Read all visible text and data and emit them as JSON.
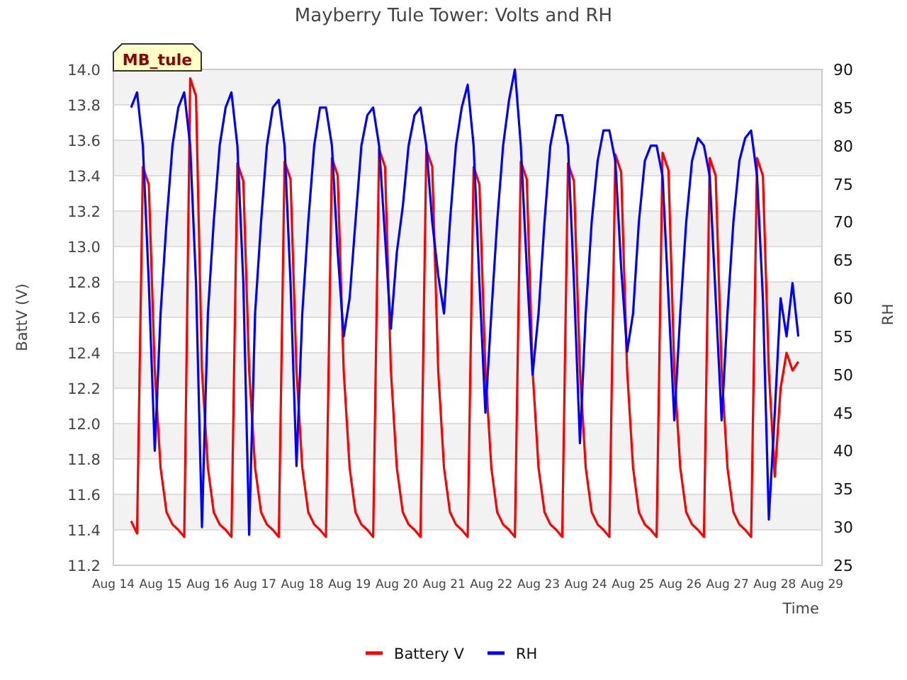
{
  "tag": {
    "label": "MB_tule"
  },
  "chart_data": {
    "type": "line",
    "title": "Mayberry Tule Tower: Volts and RH",
    "xlabel": "Time",
    "ylabel": "BattV (V)",
    "categories": [
      "Aug 14",
      null,
      null,
      null,
      null,
      null,
      null,
      null,
      "Aug 15",
      null,
      null,
      null,
      null,
      null,
      null,
      null,
      "Aug 16",
      null,
      null,
      null,
      null,
      null,
      null,
      null,
      "Aug 17",
      null,
      null,
      null,
      null,
      null,
      null,
      null,
      "Aug 18",
      null,
      null,
      null,
      null,
      null,
      null,
      null,
      "Aug 19",
      null,
      null,
      null,
      null,
      null,
      null,
      null,
      "Aug 20",
      null,
      null,
      null,
      null,
      null,
      null,
      null,
      "Aug 21",
      null,
      null,
      null,
      null,
      null,
      null,
      null,
      "Aug 22",
      null,
      null,
      null,
      null,
      null,
      null,
      null,
      "Aug 23",
      null,
      null,
      null,
      null,
      null,
      null,
      null,
      "Aug 24",
      null,
      null,
      null,
      null,
      null,
      null,
      null,
      "Aug 25",
      null,
      null,
      null,
      null,
      null,
      null,
      null,
      "Aug 26",
      null,
      null,
      null,
      null,
      null,
      null,
      null,
      "Aug 27",
      null,
      null,
      null,
      null,
      null,
      null,
      null,
      "Aug 28",
      null,
      null,
      null,
      null,
      null,
      null,
      null,
      "Aug 29"
    ],
    "series": [
      {
        "name": "Battery V",
        "color": "#ff0000",
        "values": [
          null,
          null,
          null,
          11.45,
          11.38,
          13.45,
          13.35,
          12.3,
          11.75,
          11.5,
          11.43,
          11.4,
          11.36,
          13.95,
          13.85,
          12.3,
          11.75,
          11.5,
          11.43,
          11.4,
          11.36,
          13.47,
          13.37,
          12.3,
          11.75,
          11.5,
          11.43,
          11.4,
          11.36,
          13.48,
          13.38,
          12.3,
          11.75,
          11.5,
          11.43,
          11.4,
          11.36,
          13.5,
          13.4,
          12.3,
          11.75,
          11.5,
          11.43,
          11.4,
          11.36,
          13.55,
          13.45,
          12.3,
          11.75,
          11.5,
          11.43,
          11.4,
          11.36,
          13.55,
          13.45,
          12.3,
          11.75,
          11.5,
          11.43,
          11.4,
          11.36,
          13.45,
          13.35,
          12.3,
          11.75,
          11.5,
          11.43,
          11.4,
          11.36,
          13.48,
          13.38,
          12.3,
          11.75,
          11.5,
          11.43,
          11.4,
          11.36,
          13.47,
          13.37,
          12.3,
          11.75,
          11.5,
          11.43,
          11.4,
          11.36,
          13.52,
          13.42,
          12.3,
          11.75,
          11.5,
          11.43,
          11.4,
          11.36,
          13.53,
          13.43,
          12.3,
          11.75,
          11.5,
          11.43,
          11.4,
          11.36,
          13.5,
          13.4,
          12.3,
          11.75,
          11.5,
          11.43,
          11.4,
          11.36,
          13.5,
          13.4,
          12.3,
          11.7,
          12.2,
          12.4,
          12.3,
          12.35,
          null,
          null,
          null,
          null
        ]
      }
    ],
    "ylim": [
      11.2,
      14.0
    ],
    "grid": true,
    "yticks": [
      {
        "value": 11.2,
        "label": "11.2"
      },
      {
        "value": 11.4,
        "label": "11.4"
      },
      {
        "value": 11.6,
        "label": "11.6"
      },
      {
        "value": 11.8,
        "label": "11.8"
      },
      {
        "value": 12.0,
        "label": "12.0"
      },
      {
        "value": 12.2,
        "label": "12.2"
      },
      {
        "value": 12.4,
        "label": "12.4"
      },
      {
        "value": 12.6,
        "label": "12.6"
      },
      {
        "value": 12.8,
        "label": "12.8"
      },
      {
        "value": 13.0,
        "label": "13.0"
      },
      {
        "value": 13.2,
        "label": "13.2"
      },
      {
        "value": 13.4,
        "label": "13.4"
      },
      {
        "value": 13.6,
        "label": "13.6"
      },
      {
        "value": 13.8,
        "label": "13.8"
      },
      {
        "value": 14.0,
        "label": "14.0"
      }
    ]
  },
  "right_axis": {
    "chart_data": {
      "type": "line",
      "ylabel": "RH",
      "ylim": [
        25,
        90
      ],
      "series": [
        {
          "name": "RH",
          "color": "#0000ff",
          "values": [
            null,
            null,
            null,
            85,
            87,
            80,
            62,
            40,
            58,
            70,
            80,
            85,
            87,
            80,
            62,
            30,
            58,
            70,
            80,
            85,
            87,
            80,
            62,
            29,
            58,
            70,
            80,
            85,
            86,
            80,
            62,
            38,
            58,
            70,
            80,
            85,
            85,
            80,
            66,
            55,
            60,
            70,
            80,
            84,
            85,
            80,
            68,
            56,
            66,
            72,
            80,
            84,
            85,
            80,
            70,
            63,
            58,
            70,
            80,
            85,
            88,
            80,
            62,
            45,
            58,
            70,
            80,
            86,
            90,
            80,
            64,
            50,
            58,
            70,
            80,
            84,
            84,
            80,
            62,
            41,
            58,
            70,
            78,
            82,
            82,
            78,
            64,
            53,
            58,
            70,
            78,
            80,
            80,
            76,
            60,
            44,
            58,
            70,
            78,
            81,
            80,
            76,
            60,
            44,
            58,
            70,
            78,
            81,
            82,
            76,
            60,
            31,
            45,
            60,
            55,
            62,
            55,
            null,
            null,
            null,
            null
          ]
        }
      ],
      "yticks": [
        25,
        30,
        35,
        40,
        45,
        50,
        55,
        60,
        65,
        70,
        75,
        80,
        85,
        90
      ]
    }
  }
}
